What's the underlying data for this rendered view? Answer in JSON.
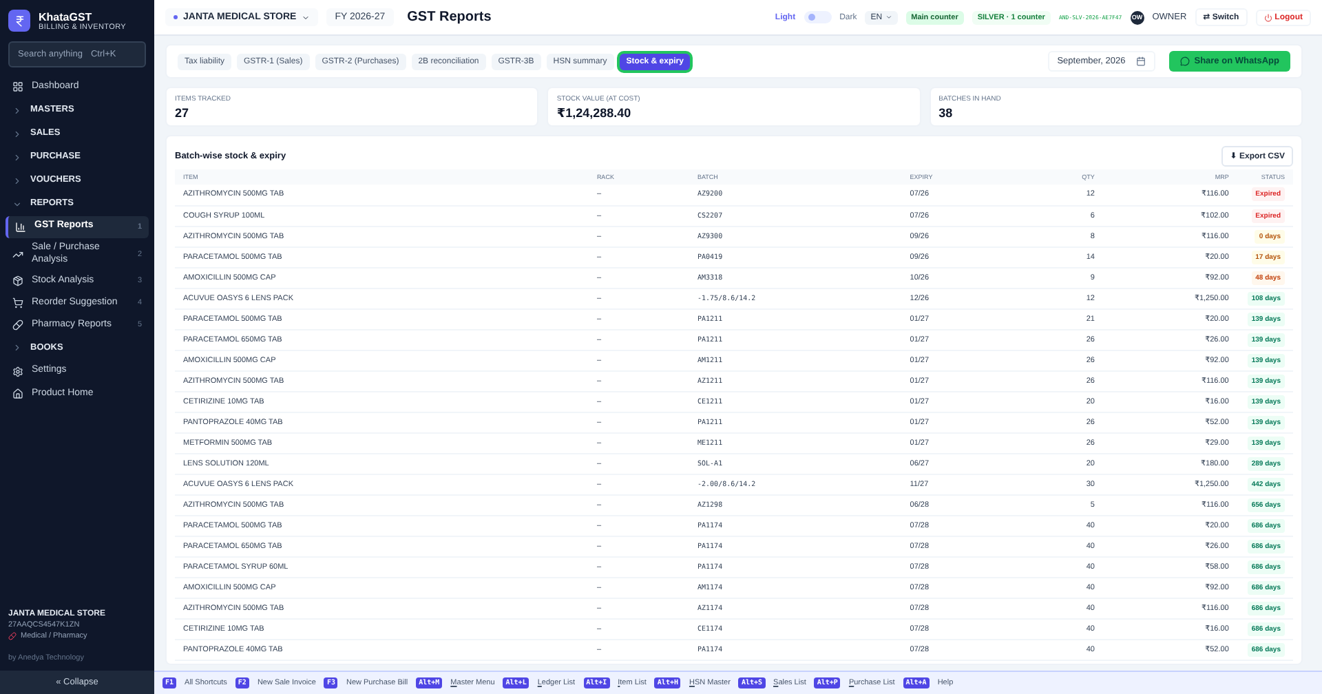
{
  "sidebar": {
    "brand": {
      "name": "KhataGST",
      "tagline": "BILLING & INVENTORY"
    },
    "search": {
      "placeholder": "Search anything",
      "shortcut": "Ctrl+K"
    },
    "items": [
      {
        "kind": "link",
        "label": "Dashboard"
      },
      {
        "kind": "section",
        "label": "MASTERS",
        "expanded": false
      },
      {
        "kind": "section",
        "label": "SALES",
        "expanded": false
      },
      {
        "kind": "section",
        "label": "PURCHASE",
        "expanded": false
      },
      {
        "kind": "section",
        "label": "VOUCHERS",
        "expanded": false
      },
      {
        "kind": "section",
        "label": "REPORTS",
        "expanded": true,
        "children": [
          {
            "label": "GST Reports",
            "count": "1",
            "selected": true
          },
          {
            "label": "Sale / Purchase Analysis",
            "count": "2",
            "selected": false
          },
          {
            "label": "Stock Analysis",
            "count": "3",
            "selected": false
          },
          {
            "label": "Reorder Suggestion",
            "count": "4",
            "selected": false
          },
          {
            "label": "Pharmacy Reports",
            "count": "5",
            "selected": false
          }
        ]
      },
      {
        "kind": "section",
        "label": "BOOKS",
        "expanded": false
      },
      {
        "kind": "link",
        "label": "Settings"
      },
      {
        "kind": "link",
        "label": "Product Home"
      }
    ],
    "company": {
      "name": "JANTA MEDICAL STORE",
      "gstin": "27AAQCS4547K1ZN",
      "type": "Medical / Pharmacy"
    },
    "credit": "by Anedya Technology",
    "collapse": "« Collapse"
  },
  "topbar": {
    "store": "JANTA MEDICAL STORE",
    "fy": "FY 2026-27",
    "title": "GST Reports",
    "theme": {
      "light": "Light",
      "dark": "Dark",
      "dark_on": false
    },
    "language": "EN",
    "counter": "Main counter",
    "plan": "SILVER · 1 counter",
    "license": "AND-SLV-2026-AE7F47",
    "user": {
      "initials": "OW",
      "role": "OWNER"
    },
    "switch": "⇄ Switch",
    "logout": "Logout"
  },
  "tabs": [
    {
      "label": "Tax liability",
      "selected": false
    },
    {
      "label": "GSTR-1 (Sales)",
      "selected": false
    },
    {
      "label": "GSTR-2 (Purchases)",
      "selected": false
    },
    {
      "label": "2B reconciliation",
      "selected": false
    },
    {
      "label": "GSTR-3B",
      "selected": false
    },
    {
      "label": "HSN summary",
      "selected": false
    },
    {
      "label": "Stock & expiry",
      "selected": true
    }
  ],
  "period": "September, 2026",
  "share": "Share on WhatsApp",
  "stats": [
    {
      "label": "ITEMS TRACKED",
      "value": "27"
    },
    {
      "label": "STOCK VALUE (AT COST)",
      "value": "₹1,24,288.40"
    },
    {
      "label": "BATCHES IN HAND",
      "value": "38"
    }
  ],
  "table": {
    "title": "Batch-wise stock & expiry",
    "export": "⬇ Export CSV",
    "columns": [
      "ITEM",
      "RACK",
      "BATCH",
      "EXPIRY",
      "QTY",
      "MRP",
      "STATUS"
    ],
    "rows": [
      {
        "item": "AZITHROMYCIN 500MG TAB",
        "rack": "–",
        "batch": "AZ9200",
        "expiry": "07/26",
        "qty": "12",
        "mrp": "₹116.00",
        "status": "Expired",
        "color": "#dc2626"
      },
      {
        "item": "COUGH SYRUP 100ML",
        "rack": "–",
        "batch": "CS2207",
        "expiry": "07/26",
        "qty": "6",
        "mrp": "₹102.00",
        "status": "Expired",
        "color": "#dc2626"
      },
      {
        "item": "AZITHROMYCIN 500MG TAB",
        "rack": "–",
        "batch": "AZ9300",
        "expiry": "09/26",
        "qty": "8",
        "mrp": "₹116.00",
        "status": "0 days",
        "color": "#b45309"
      },
      {
        "item": "PARACETAMOL 500MG TAB",
        "rack": "–",
        "batch": "PA0419",
        "expiry": "09/26",
        "qty": "14",
        "mrp": "₹20.00",
        "status": "17 days",
        "color": "#b45309"
      },
      {
        "item": "AMOXICILLIN 500MG CAP",
        "rack": "–",
        "batch": "AM3318",
        "expiry": "10/26",
        "qty": "9",
        "mrp": "₹92.00",
        "status": "48 days",
        "color": "#c2410c"
      },
      {
        "item": "ACUVUE OASYS 6 LENS PACK",
        "rack": "–",
        "batch": "-1.75/8.6/14.2",
        "expiry": "12/26",
        "qty": "12",
        "mrp": "₹1,250.00",
        "status": "108 days",
        "color": "#047857"
      },
      {
        "item": "PARACETAMOL 500MG TAB",
        "rack": "–",
        "batch": "PA1211",
        "expiry": "01/27",
        "qty": "21",
        "mrp": "₹20.00",
        "status": "139 days",
        "color": "#047857"
      },
      {
        "item": "PARACETAMOL 650MG TAB",
        "rack": "–",
        "batch": "PA1211",
        "expiry": "01/27",
        "qty": "26",
        "mrp": "₹26.00",
        "status": "139 days",
        "color": "#047857"
      },
      {
        "item": "AMOXICILLIN 500MG CAP",
        "rack": "–",
        "batch": "AM1211",
        "expiry": "01/27",
        "qty": "26",
        "mrp": "₹92.00",
        "status": "139 days",
        "color": "#047857"
      },
      {
        "item": "AZITHROMYCIN 500MG TAB",
        "rack": "–",
        "batch": "AZ1211",
        "expiry": "01/27",
        "qty": "26",
        "mrp": "₹116.00",
        "status": "139 days",
        "color": "#047857"
      },
      {
        "item": "CETIRIZINE 10MG TAB",
        "rack": "–",
        "batch": "CE1211",
        "expiry": "01/27",
        "qty": "20",
        "mrp": "₹16.00",
        "status": "139 days",
        "color": "#047857"
      },
      {
        "item": "PANTOPRAZOLE 40MG TAB",
        "rack": "–",
        "batch": "PA1211",
        "expiry": "01/27",
        "qty": "26",
        "mrp": "₹52.00",
        "status": "139 days",
        "color": "#047857"
      },
      {
        "item": "METFORMIN 500MG TAB",
        "rack": "–",
        "batch": "ME1211",
        "expiry": "01/27",
        "qty": "26",
        "mrp": "₹29.00",
        "status": "139 days",
        "color": "#047857"
      },
      {
        "item": "LENS SOLUTION 120ML",
        "rack": "–",
        "batch": "SOL-A1",
        "expiry": "06/27",
        "qty": "20",
        "mrp": "₹180.00",
        "status": "289 days",
        "color": "#047857"
      },
      {
        "item": "ACUVUE OASYS 6 LENS PACK",
        "rack": "–",
        "batch": "-2.00/8.6/14.2",
        "expiry": "11/27",
        "qty": "30",
        "mrp": "₹1,250.00",
        "status": "442 days",
        "color": "#047857"
      },
      {
        "item": "AZITHROMYCIN 500MG TAB",
        "rack": "–",
        "batch": "AZ1298",
        "expiry": "06/28",
        "qty": "5",
        "mrp": "₹116.00",
        "status": "656 days",
        "color": "#047857"
      },
      {
        "item": "PARACETAMOL 500MG TAB",
        "rack": "–",
        "batch": "PA1174",
        "expiry": "07/28",
        "qty": "40",
        "mrp": "₹20.00",
        "status": "686 days",
        "color": "#047857"
      },
      {
        "item": "PARACETAMOL 650MG TAB",
        "rack": "–",
        "batch": "PA1174",
        "expiry": "07/28",
        "qty": "40",
        "mrp": "₹26.00",
        "status": "686 days",
        "color": "#047857"
      },
      {
        "item": "PARACETAMOL SYRUP 60ML",
        "rack": "–",
        "batch": "PA1174",
        "expiry": "07/28",
        "qty": "40",
        "mrp": "₹58.00",
        "status": "686 days",
        "color": "#047857"
      },
      {
        "item": "AMOXICILLIN 500MG CAP",
        "rack": "–",
        "batch": "AM1174",
        "expiry": "07/28",
        "qty": "40",
        "mrp": "₹92.00",
        "status": "686 days",
        "color": "#047857"
      },
      {
        "item": "AZITHROMYCIN 500MG TAB",
        "rack": "–",
        "batch": "AZ1174",
        "expiry": "07/28",
        "qty": "40",
        "mrp": "₹116.00",
        "status": "686 days",
        "color": "#047857"
      },
      {
        "item": "CETIRIZINE 10MG TAB",
        "rack": "–",
        "batch": "CE1174",
        "expiry": "07/28",
        "qty": "40",
        "mrp": "₹16.00",
        "status": "686 days",
        "color": "#047857"
      },
      {
        "item": "PANTOPRAZOLE 40MG TAB",
        "rack": "–",
        "batch": "PA1174",
        "expiry": "07/28",
        "qty": "40",
        "mrp": "₹52.00",
        "status": "686 days",
        "color": "#047857"
      }
    ]
  },
  "shortcuts": [
    {
      "key": "F1",
      "label": "All Shortcuts",
      "mnemonic": false
    },
    {
      "key": "F2",
      "label": "New Sale Invoice",
      "mnemonic": false
    },
    {
      "key": "F3",
      "label": "New Purchase Bill",
      "mnemonic": false
    },
    {
      "key": "Alt+M",
      "label": "Master Menu",
      "mnemonic": true
    },
    {
      "key": "Alt+L",
      "label": "Ledger List",
      "mnemonic": true
    },
    {
      "key": "Alt+I",
      "label": "Item List",
      "mnemonic": true
    },
    {
      "key": "Alt+H",
      "label": "HSN Master",
      "mnemonic": true
    },
    {
      "key": "Alt+S",
      "label": "Sales List",
      "mnemonic": true
    },
    {
      "key": "Alt+P",
      "label": "Purchase List",
      "mnemonic": true
    },
    {
      "key": "Alt+A",
      "label": "Help",
      "mnemonic": false
    }
  ]
}
